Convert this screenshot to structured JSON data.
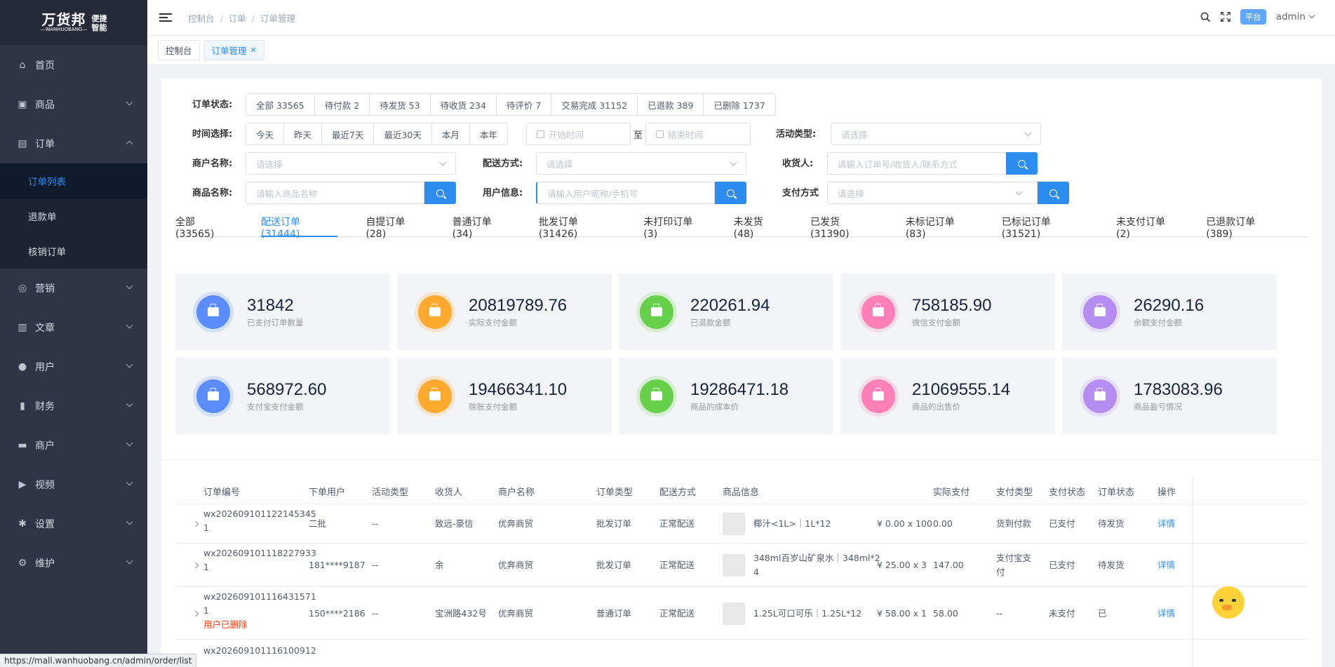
{
  "sidebar": {
    "logo": {
      "brand": "万货邦",
      "sub": "—WANHUOBANG—",
      "tag1": "便捷",
      "tag2": "智能"
    },
    "items": [
      {
        "label": "首页",
        "icon": "home-icon",
        "expandable": false
      },
      {
        "label": "商品",
        "icon": "goods-icon",
        "expandable": true
      },
      {
        "label": "订单",
        "icon": "order-icon",
        "expandable": true,
        "open": true
      },
      {
        "label": "营销",
        "icon": "marketing-icon",
        "expandable": true
      },
      {
        "label": "文章",
        "icon": "article-icon",
        "expandable": true
      },
      {
        "label": "用户",
        "icon": "user-icon",
        "expandable": true
      },
      {
        "label": "财务",
        "icon": "finance-icon",
        "expandable": true
      },
      {
        "label": "商户",
        "icon": "merchant-icon",
        "expandable": true
      },
      {
        "label": "视频",
        "icon": "video-icon",
        "expandable": true
      },
      {
        "label": "设置",
        "icon": "settings-icon",
        "expandable": true
      },
      {
        "label": "维护",
        "icon": "maintenance-icon",
        "expandable": true
      }
    ],
    "order_sub": [
      "订单列表",
      "退款单",
      "核销订单"
    ],
    "active_sub": "订单列表"
  },
  "header": {
    "breadcrumb": [
      "控制台",
      "订单",
      "订单管理"
    ],
    "platform": "平台",
    "user": "admin"
  },
  "tags": [
    {
      "label": "控制台",
      "active": false
    },
    {
      "label": "订单管理",
      "active": true
    }
  ],
  "filters": {
    "status_label": "订单状态:",
    "status_options": [
      "全部 33565",
      "待付款 2",
      "待发货 53",
      "待收货 234",
      "待评价 7",
      "交易完成 31152",
      "已退款 389",
      "已删除 1737"
    ],
    "time_label": "时间选择:",
    "time_options": [
      "今天",
      "昨天",
      "最近7天",
      "最近30天",
      "本月",
      "本年"
    ],
    "start_placeholder": "开始时间",
    "to": "至",
    "end_placeholder": "结束时间",
    "activity_label": "活动类型:",
    "activity_placeholder": "请选择",
    "merchant_label": "商户名称:",
    "merchant_placeholder": "请选择",
    "delivery_label": "配送方式:",
    "delivery_placeholder": "请选择",
    "receiver_label": "收货人:",
    "receiver_placeholder": "请输入订单号/收货人/联系方式",
    "product_label": "商品名称:",
    "product_placeholder": "请输入商品名称",
    "userinfo_label": "用户信息:",
    "userinfo_placeholder": "请输入用户昵称/手机号",
    "payment_label": "支付方式",
    "payment_placeholder": "请选择"
  },
  "order_tabs": [
    "全部(33565)",
    "配送订单(31444)",
    "自提订单(28)",
    "普通订单(34)",
    "批发订单(31426)",
    "未打印订单(3)",
    "未发货(48)",
    "已发货(31390)",
    "未标记订单(83)",
    "已标记订单(31521)",
    "未支付订单(2)",
    "已退款订单(389)"
  ],
  "active_order_tab": "配送订单(31444)",
  "stats": [
    {
      "value": "31842",
      "label": "已支付订单数量",
      "color": "#5b8cff",
      "icon": "bag-icon"
    },
    {
      "value": "20819789.76",
      "label": "实际支付金额",
      "color": "#ffa92e",
      "icon": "clipboard-icon"
    },
    {
      "value": "220261.94",
      "label": "已退款金额",
      "color": "#67d04a",
      "icon": "briefcase-icon"
    },
    {
      "value": "758185.90",
      "label": "微信支付金额",
      "color": "#ff7fb6",
      "icon": "briefcase-icon"
    },
    {
      "value": "26290.16",
      "label": "余额支付金额",
      "color": "#b58cf0",
      "icon": "wallet-icon"
    },
    {
      "value": "568972.60",
      "label": "支付宝支付金额",
      "color": "#5b8cff",
      "icon": "briefcase-icon"
    },
    {
      "value": "19466341.10",
      "label": "赊账支付金额",
      "color": "#ffa92e",
      "icon": "briefcase-icon"
    },
    {
      "value": "19286471.18",
      "label": "商品的成本价",
      "color": "#67d04a",
      "icon": "wallet-icon"
    },
    {
      "value": "21069555.14",
      "label": "商品的出售价",
      "color": "#ff7fb6",
      "icon": "clipboard-icon"
    },
    {
      "value": "1783083.96",
      "label": "商品盈亏情况",
      "color": "#b58cf0",
      "icon": "bag-icon"
    }
  ],
  "table": {
    "headers": [
      "订单编号",
      "下单用户",
      "活动类型",
      "收货人",
      "商户名称",
      "订单类型",
      "配送方式",
      "商品信息",
      "实际支付",
      "支付类型",
      "支付状态",
      "订单状态",
      "操作"
    ],
    "rows": [
      {
        "order_no": "wx202609101122145345",
        "order_no2": "1",
        "user": "二批",
        "activity": "--",
        "receiver": "致远-豪信",
        "merchant": "优奔商贸",
        "type": "批发订单",
        "delivery": "正常配送",
        "product": "椰汁<1L>｜1L*12",
        "product2": "",
        "price": "¥ 0.00 x 100",
        "paid": "0.00",
        "pay_type": "货到付款",
        "pay_type2": "",
        "pay_status": "已支付",
        "status": "待发货",
        "action": "详情",
        "deleted": ""
      },
      {
        "order_no": "wx202609101118227933",
        "order_no2": "1",
        "user": "181****9187",
        "activity": "--",
        "receiver": "余",
        "merchant": "优奔商贸",
        "type": "批发订单",
        "delivery": "正常配送",
        "product": "348ml百岁山矿泉水｜348ml*2",
        "product2": "4",
        "price": "¥ 25.00 x 3",
        "paid": "147.00",
        "pay_type": "支付宝支",
        "pay_type2": "付",
        "pay_status": "已支付",
        "status": "待发货",
        "action": "详情",
        "deleted": ""
      },
      {
        "order_no": "wx202609101116431571",
        "order_no2": "1",
        "user": "150****2186",
        "activity": "--",
        "receiver": "宝洲路432号",
        "merchant": "优奔商贸",
        "type": "普通订单",
        "delivery": "正常配送",
        "product": "1.25L可口可乐｜1.25L*12",
        "product2": "",
        "price": "¥ 58.00 x 1",
        "paid": "58.00",
        "pay_type": "--",
        "pay_type2": "",
        "pay_status": "未支付",
        "status": "已",
        "action": "详情",
        "deleted": "用户已删除"
      },
      {
        "order_no": "wx202609101116100912",
        "order_no2": "",
        "user": "",
        "activity": "",
        "receiver": "",
        "merchant": "",
        "type": "",
        "delivery": "",
        "product": "",
        "product2": "",
        "price": "",
        "paid": "",
        "pay_type": "",
        "pay_type2": "",
        "pay_status": "",
        "status": "",
        "action": "",
        "deleted": ""
      }
    ]
  },
  "status_url": "https://mall.wanhuobang.cn/admin/order/list"
}
